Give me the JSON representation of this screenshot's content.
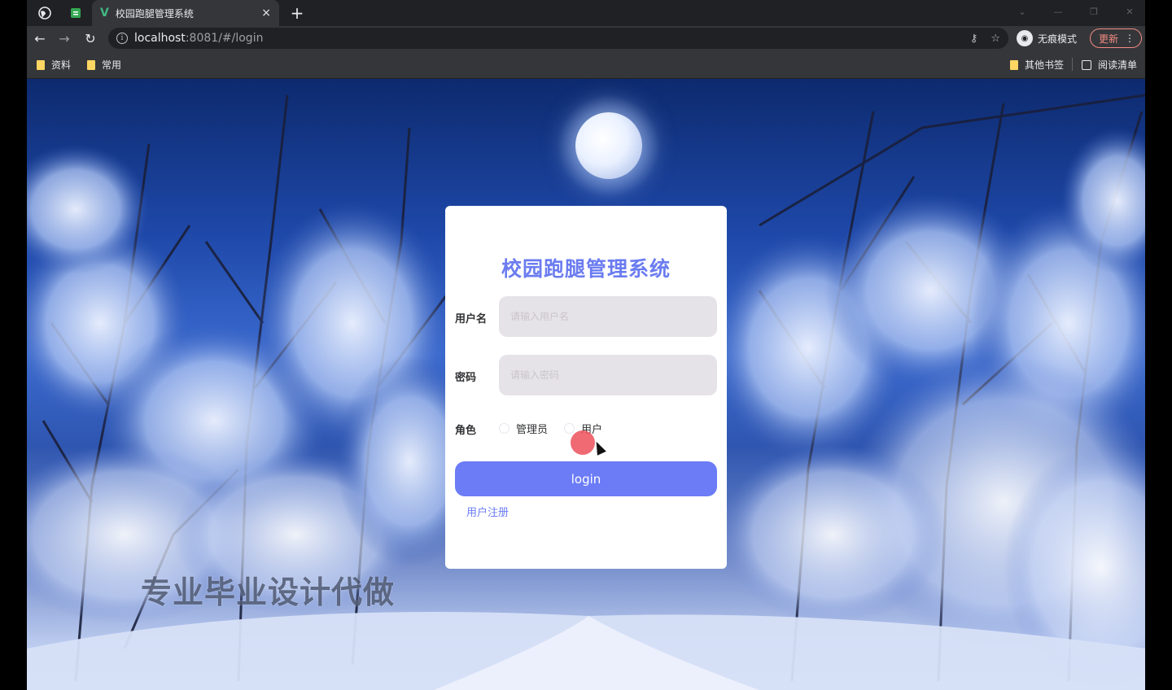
{
  "browser": {
    "tab_title": "校园跑腿管理系统",
    "tab_close": "×",
    "new_tab": "+",
    "url_host": "localhost",
    "url_path": ":8081/#/login",
    "incognito_label": "无痕模式",
    "update_label": "更新",
    "update_more": "⋮"
  },
  "bookmarks": {
    "left": [
      "资料",
      "常用"
    ],
    "other": "其他书签",
    "reading_list": "阅读清单"
  },
  "login": {
    "title": "校园跑腿管理系统",
    "username_label": "用户名",
    "username_placeholder": "请输入用户名",
    "password_label": "密码",
    "password_placeholder": "请输入密码",
    "role_label": "角色",
    "roles": [
      "管理员",
      "用户"
    ],
    "login_button": "login",
    "register_link": "用户注册"
  },
  "overlay": {
    "watermark": "专业毕业设计代做"
  },
  "colors": {
    "accent": "#6b7cf6",
    "title": "#6b7cf0",
    "input_bg": "#e6e3e8"
  }
}
